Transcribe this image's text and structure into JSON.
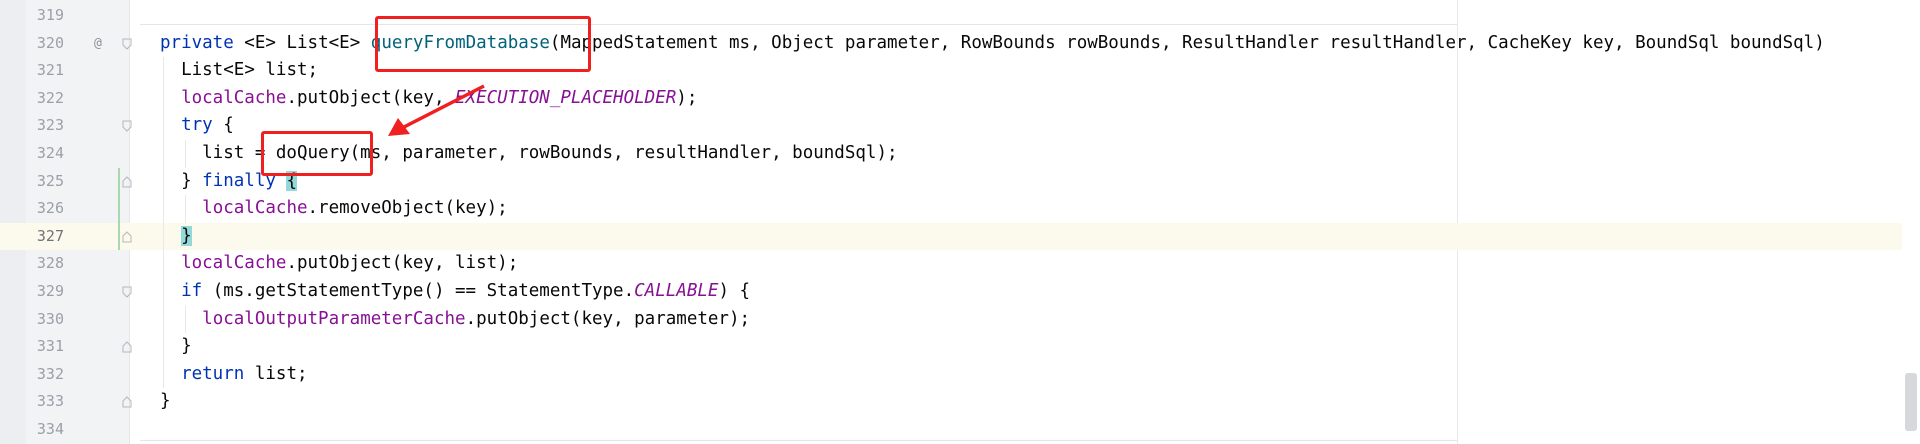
{
  "editor": {
    "lines": [
      {
        "num": "319",
        "tokens": []
      },
      {
        "num": "320",
        "tokens": [
          {
            "t": "private ",
            "c": "tok-kw"
          },
          {
            "t": "<",
            "c": "tok-plain"
          },
          {
            "t": "E",
            "c": "tok-plain"
          },
          {
            "t": "> List<",
            "c": "tok-plain"
          },
          {
            "t": "E",
            "c": "tok-plain"
          },
          {
            "t": "> ",
            "c": "tok-plain"
          },
          {
            "t": "queryFromDatabase",
            "c": "tok-method"
          },
          {
            "t": "(MappedStatement ms, Object parameter, RowBounds rowBounds, ResultHandler resultHandler, CacheKey key, BoundSql boundSql)",
            "c": "tok-plain"
          }
        ]
      },
      {
        "num": "321",
        "tokens": [
          {
            "t": "  List<",
            "c": "tok-plain"
          },
          {
            "t": "E",
            "c": "tok-plain"
          },
          {
            "t": "> list;",
            "c": "tok-plain"
          }
        ]
      },
      {
        "num": "322",
        "tokens": [
          {
            "t": "  ",
            "c": "tok-plain"
          },
          {
            "t": "localCache",
            "c": "tok-field"
          },
          {
            "t": ".putObject(key, ",
            "c": "tok-plain"
          },
          {
            "t": "EXECUTION_PLACEHOLDER",
            "c": "tok-const"
          },
          {
            "t": ");",
            "c": "tok-plain"
          }
        ]
      },
      {
        "num": "323",
        "tokens": [
          {
            "t": "  ",
            "c": "tok-plain"
          },
          {
            "t": "try",
            "c": "tok-kw"
          },
          {
            "t": " {",
            "c": "tok-plain"
          }
        ]
      },
      {
        "num": "324",
        "tokens": [
          {
            "t": "    list = doQuery(ms, parameter, rowBounds, resultHandler, boundSql);",
            "c": "tok-plain"
          }
        ]
      },
      {
        "num": "325",
        "tokens": [
          {
            "t": "  } ",
            "c": "tok-plain"
          },
          {
            "t": "finally",
            "c": "tok-kw"
          },
          {
            "t": " ",
            "c": "tok-plain"
          },
          {
            "t": "{",
            "c": "tok-brace-match"
          }
        ]
      },
      {
        "num": "326",
        "tokens": [
          {
            "t": "    ",
            "c": "tok-plain"
          },
          {
            "t": "localCache",
            "c": "tok-field"
          },
          {
            "t": ".removeObject(key);",
            "c": "tok-plain"
          }
        ]
      },
      {
        "num": "327",
        "tokens": [
          {
            "t": "  ",
            "c": "tok-plain"
          },
          {
            "t": "}",
            "c": "tok-brace-match"
          }
        ]
      },
      {
        "num": "328",
        "tokens": [
          {
            "t": "  ",
            "c": "tok-plain"
          },
          {
            "t": "localCache",
            "c": "tok-field"
          },
          {
            "t": ".putObject(key, list);",
            "c": "tok-plain"
          }
        ]
      },
      {
        "num": "329",
        "tokens": [
          {
            "t": "  ",
            "c": "tok-plain"
          },
          {
            "t": "if",
            "c": "tok-kw"
          },
          {
            "t": " (ms.getStatementType() == StatementType.",
            "c": "tok-plain"
          },
          {
            "t": "CALLABLE",
            "c": "tok-const"
          },
          {
            "t": ") {",
            "c": "tok-plain"
          }
        ]
      },
      {
        "num": "330",
        "tokens": [
          {
            "t": "    ",
            "c": "tok-plain"
          },
          {
            "t": "localOutputParameterCache",
            "c": "tok-field"
          },
          {
            "t": ".putObject(key, parameter);",
            "c": "tok-plain"
          }
        ]
      },
      {
        "num": "331",
        "tokens": [
          {
            "t": "  }",
            "c": "tok-plain"
          }
        ]
      },
      {
        "num": "332",
        "tokens": [
          {
            "t": "  ",
            "c": "tok-plain"
          },
          {
            "t": "return",
            "c": "tok-kw"
          },
          {
            "t": " list;",
            "c": "tok-plain"
          }
        ]
      },
      {
        "num": "333",
        "tokens": [
          {
            "t": "}",
            "c": "tok-plain"
          }
        ]
      },
      {
        "num": "334",
        "tokens": []
      }
    ],
    "current_line": "327",
    "override_marker": "@"
  },
  "colors": {
    "keyword": "#0033b3",
    "field": "#871094",
    "method": "#00627a",
    "annotation": "#f02020",
    "current_line_bg": "#fcfaed",
    "brace_match": "#93d9d9"
  }
}
